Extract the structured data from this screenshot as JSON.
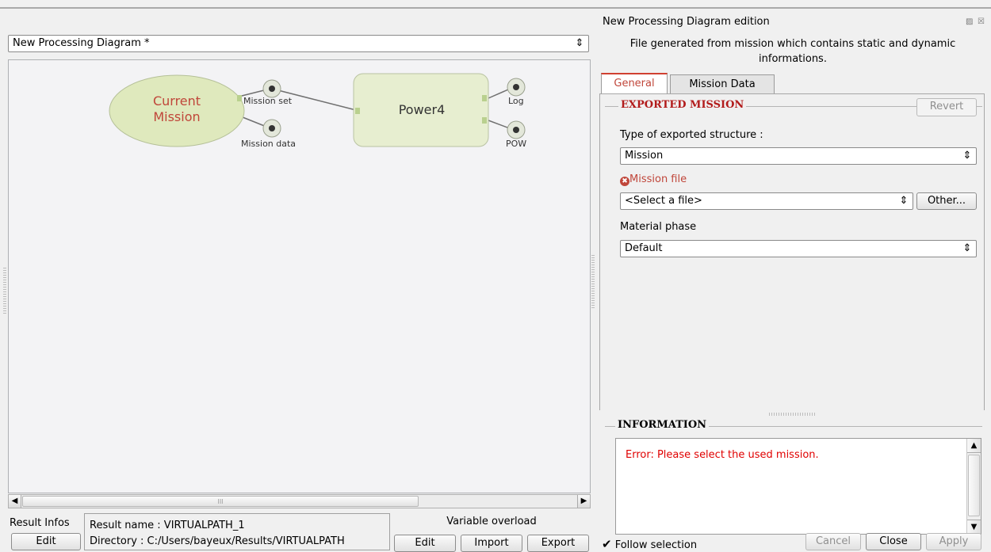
{
  "diagram": {
    "selector_value": "New Processing Diagram *",
    "nodes": {
      "current_mission": "Current\nMission",
      "power": "Power4",
      "port_mission_set": "Mission set",
      "port_mission_data": "Mission data",
      "port_log": "Log",
      "port_pow": "POW"
    }
  },
  "scrollbar": {
    "grip": "III"
  },
  "result_infos": {
    "label": "Result Infos",
    "edit_label": "Edit",
    "result_name": "Result name : VIRTUALPATH_1",
    "directory": "Directory : C:/Users/bayeux/Results/VIRTUALPATH"
  },
  "variable_overload": {
    "label": "Variable overload",
    "edit_label": "Edit",
    "import_label": "Import",
    "export_label": "Export"
  },
  "panel": {
    "title": "New Processing Diagram edition",
    "description": "File generated from mission which contains static and dynamic informations.",
    "tabs": [
      {
        "label": "General",
        "active": true
      },
      {
        "label": "Mission Data",
        "active": false
      }
    ],
    "exported_mission": {
      "group_title": "EXPORTED MISSION",
      "revert_label": "Revert",
      "type_label": "Type of exported structure :",
      "type_value": "Mission",
      "mission_file_label": "Mission file",
      "mission_file_value": "<Select a file>",
      "other_label": "Other...",
      "material_label": "Material phase",
      "material_value": "Default"
    },
    "information": {
      "group_title": "INFORMATION",
      "message": "Error: Please select the used mission."
    },
    "follow_selection_label": "Follow selection",
    "follow_selection_checked": true,
    "cancel_label": "Cancel",
    "close_label": "Close",
    "apply_label": "Apply"
  },
  "colors": {
    "error": "#e00000",
    "mission_node_text": "#c0463a",
    "node_fill": "#e6edcc",
    "mission_node_fill": "#dde8b8"
  }
}
